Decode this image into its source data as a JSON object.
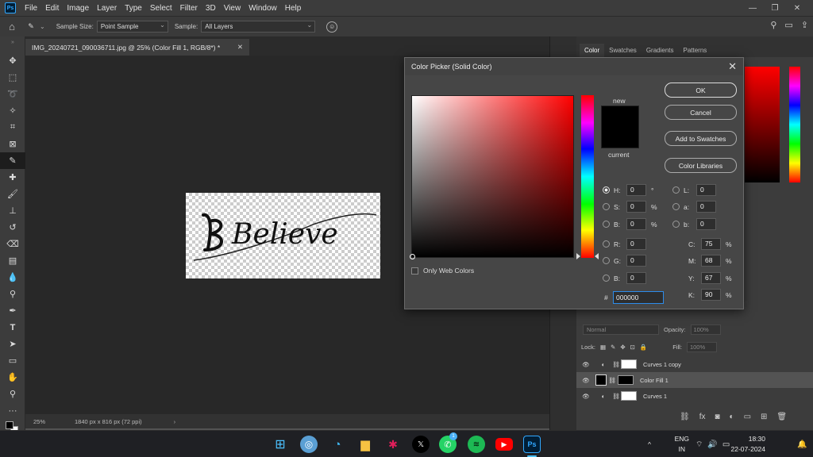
{
  "menu": [
    "File",
    "Edit",
    "Image",
    "Layer",
    "Type",
    "Select",
    "Filter",
    "3D",
    "View",
    "Window",
    "Help"
  ],
  "options": {
    "sample_size_label": "Sample Size:",
    "sample_size_value": "Point Sample",
    "sample_label": "Sample:",
    "sample_value": "All Layers"
  },
  "document": {
    "tab_title": "IMG_20240721_090036711.jpg @ 25% (Color Fill 1, RGB/8*) *",
    "zoom": "25%",
    "info": "1840 px x 816 px (72 ppi)",
    "artwork_text": "Believe"
  },
  "panel_tabs": [
    "Color",
    "Swatches",
    "Gradients",
    "Patterns"
  ],
  "layers": {
    "blend_mode": "Normal",
    "opacity_label": "Opacity:",
    "opacity_value": "100%",
    "lock_label": "Lock:",
    "fill_label": "Fill:",
    "fill_value": "100%",
    "items": [
      "Curves 1 copy",
      "Color Fill 1",
      "Curves 1"
    ]
  },
  "dialog": {
    "title": "Color Picker (Solid Color)",
    "new_label": "new",
    "current_label": "current",
    "ok": "OK",
    "cancel": "Cancel",
    "add_swatches": "Add to Swatches",
    "color_libraries": "Color Libraries",
    "only_web_colors": "Only Web Colors",
    "hex_label": "#",
    "hex_value": "000000",
    "fields": {
      "H": {
        "label": "H:",
        "value": "0",
        "unit": "°"
      },
      "S": {
        "label": "S:",
        "value": "0",
        "unit": "%"
      },
      "Bv": {
        "label": "B:",
        "value": "0",
        "unit": "%"
      },
      "R": {
        "label": "R:",
        "value": "0"
      },
      "G": {
        "label": "G:",
        "value": "0"
      },
      "B": {
        "label": "B:",
        "value": "0"
      },
      "L": {
        "label": "L:",
        "value": "0"
      },
      "a": {
        "label": "a:",
        "value": "0"
      },
      "b": {
        "label": "b:",
        "value": "0"
      },
      "C": {
        "label": "C:",
        "value": "75",
        "unit": "%"
      },
      "M": {
        "label": "M:",
        "value": "68",
        "unit": "%"
      },
      "Y": {
        "label": "Y:",
        "value": "67",
        "unit": "%"
      },
      "K": {
        "label": "K:",
        "value": "90",
        "unit": "%"
      }
    }
  },
  "taskbar": {
    "lang1": "ENG",
    "lang2": "IN",
    "time": "18:30",
    "date": "22-07-2024",
    "whatsapp_badge": "1",
    "ps_label": "Ps"
  }
}
